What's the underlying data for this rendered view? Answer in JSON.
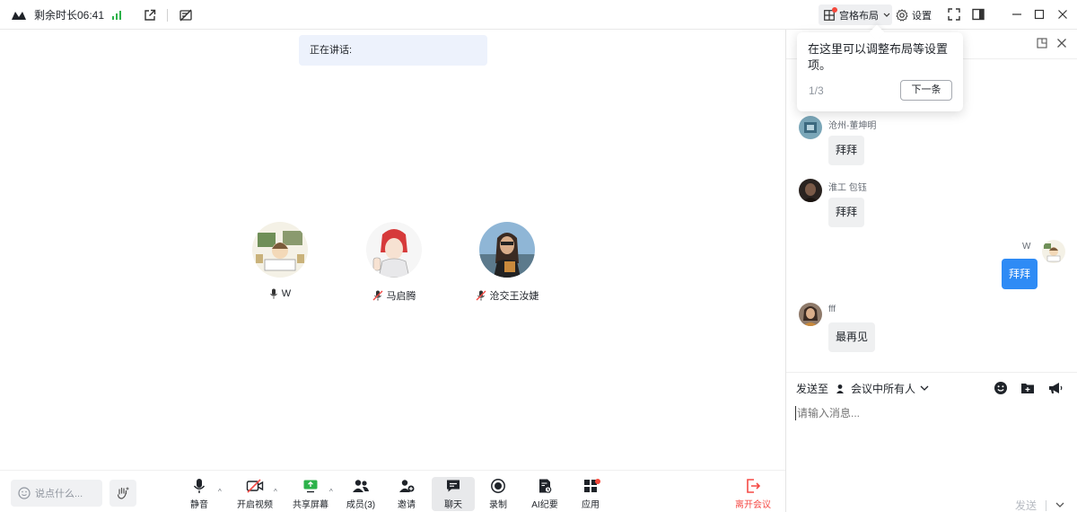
{
  "topbar": {
    "timer": "剩余时长06:41",
    "grid_layout_label": "宫格布局",
    "settings_label": "设置"
  },
  "stage": {
    "speaking_label": "正在讲话:",
    "participants": [
      {
        "name": "W",
        "mic": "on"
      },
      {
        "name": "马启腾",
        "mic": "muted"
      },
      {
        "name": "沧交王汝婕",
        "mic": "muted"
      }
    ]
  },
  "toolbar": {
    "say_placeholder": "说点什么...",
    "mute": "静音",
    "video": "开启视频",
    "share": "共享屏幕",
    "members": "成员(3)",
    "invite": "邀请",
    "chat": "聊天",
    "record": "录制",
    "ai_notes": "AI纪要",
    "apps": "应用",
    "leave": "离开会议"
  },
  "tooltip": {
    "text": "在这里可以调整布局等设置项。",
    "page": "1/3",
    "next": "下一条"
  },
  "chat": {
    "messages": [
      {
        "sender": "沧州-董坤明",
        "text": "拜拜",
        "self": false
      },
      {
        "sender": "淮工 包钰",
        "text": "拜拜",
        "self": false
      },
      {
        "sender": "W",
        "text": "拜拜",
        "self": true
      },
      {
        "sender": "fff",
        "text": "最再见",
        "self": false
      }
    ],
    "send_to_label": "发送至",
    "send_to_target": "会议中所有人",
    "input_placeholder": "请输入消息...",
    "send_label": "发送"
  },
  "colors": {
    "accent": "#2e8bf5",
    "leave": "#f54a45",
    "signal": "#2cb24a"
  }
}
